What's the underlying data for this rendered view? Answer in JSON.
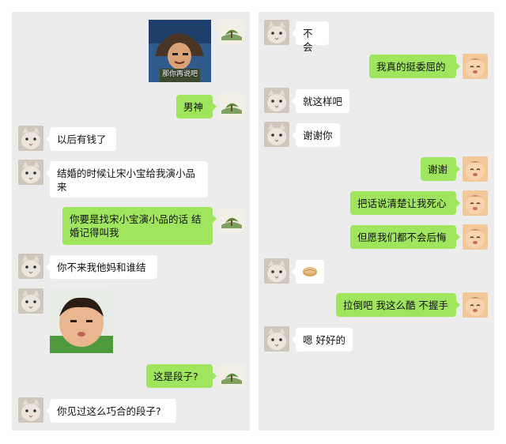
{
  "left_panel": {
    "messages": [
      {
        "from": "me",
        "type": "image",
        "image": "sticker-man-fur-hat",
        "caption": "那你再说吧"
      },
      {
        "from": "me",
        "type": "text",
        "text": "男神"
      },
      {
        "from": "other",
        "type": "text",
        "text": "以后有钱了"
      },
      {
        "from": "other",
        "type": "text",
        "text": "结婚的时候让宋小宝给我演小品来"
      },
      {
        "from": "me",
        "type": "text",
        "text": "你要是找宋小宝演小品的话 结婚记得叫我"
      },
      {
        "from": "other",
        "type": "text",
        "text": "你不来我他妈和谁结"
      },
      {
        "from": "other",
        "type": "image",
        "image": "sticker-baby-face"
      },
      {
        "from": "me",
        "type": "text",
        "text": "这是段子?"
      },
      {
        "from": "other",
        "type": "text",
        "text": "你见过这么巧合的段子?"
      }
    ]
  },
  "right_panel": {
    "messages": [
      {
        "from": "other",
        "type": "text",
        "text": "不会"
      },
      {
        "from": "me",
        "type": "text",
        "text": "我真的挺委屈的"
      },
      {
        "from": "other",
        "type": "text",
        "text": "就这样吧"
      },
      {
        "from": "other",
        "type": "text",
        "text": "谢谢你"
      },
      {
        "from": "me",
        "type": "text",
        "text": "谢谢"
      },
      {
        "from": "me",
        "type": "text",
        "text": "把话说清楚让我死心"
      },
      {
        "from": "me",
        "type": "text",
        "text": "但愿我们都不会后悔"
      },
      {
        "from": "other",
        "type": "emoji",
        "emoji": "bread-emoji"
      },
      {
        "from": "me",
        "type": "text",
        "text": "拉倒吧 我这么酷 不握手"
      },
      {
        "from": "other",
        "type": "text",
        "text": "嗯 好好的"
      }
    ]
  },
  "colors": {
    "panel_background": "#ececec",
    "my_bubble": "#9fe65e",
    "their_bubble": "#ffffff"
  }
}
